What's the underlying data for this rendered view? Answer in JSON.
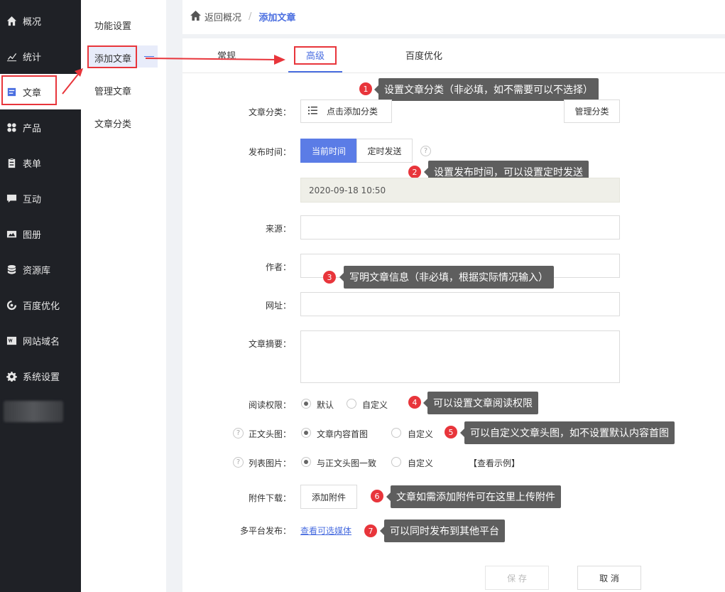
{
  "sidebar": {
    "items": [
      {
        "label": "概况",
        "icon": "home-icon"
      },
      {
        "label": "统计",
        "icon": "stats-icon"
      },
      {
        "label": "文章",
        "icon": "article-icon"
      },
      {
        "label": "产品",
        "icon": "product-icon"
      },
      {
        "label": "表单",
        "icon": "form-icon"
      },
      {
        "label": "互动",
        "icon": "chat-icon"
      },
      {
        "label": "图册",
        "icon": "gallery-icon"
      },
      {
        "label": "资源库",
        "icon": "database-icon"
      },
      {
        "label": "百度优化",
        "icon": "seo-icon"
      },
      {
        "label": "网站域名",
        "icon": "domain-icon"
      },
      {
        "label": "系统设置",
        "icon": "gear-icon"
      }
    ]
  },
  "submenu": {
    "items": [
      "功能设置",
      "添加文章",
      "管理文章",
      "文章分类"
    ]
  },
  "breadcrumb": {
    "back": "返回概况",
    "separator": "/",
    "current": "添加文章"
  },
  "tabs": [
    "常规",
    "高级",
    "百度优化"
  ],
  "form": {
    "category_label": "文章分类：",
    "category_add": "点击添加分类",
    "category_manage": "管理分类",
    "publish_label": "发布时间：",
    "publish_now": "当前时间",
    "publish_timed": "定时发送",
    "publish_value": "2020-09-18 10:50",
    "source_label": "来源：",
    "author_label": "作者：",
    "url_label": "网址：",
    "summary_label": "文章摘要：",
    "read_label": "阅读权限：",
    "read_default": "默认",
    "read_custom": "自定义",
    "header_label": "正文头图：",
    "header_first": "文章内容首图",
    "header_custom": "自定义",
    "list_label": "列表图片：",
    "list_same": "与正文头图一致",
    "list_custom": "自定义",
    "list_example": "【查看示例】",
    "attach_label": "附件下载：",
    "attach_add": "添加附件",
    "multi_label": "多平台发布：",
    "multi_link": "查看可选媒体",
    "save": "保 存",
    "cancel": "取 消"
  },
  "tips": [
    {
      "num": "1",
      "text": "设置文章分类（非必填，如不需要可以不选择）"
    },
    {
      "num": "2",
      "text": "设置发布时间，可以设置定时发送"
    },
    {
      "num": "3",
      "text": "写明文章信息（非必填，根据实际情况输入）"
    },
    {
      "num": "4",
      "text": "可以设置文章阅读权限"
    },
    {
      "num": "5",
      "text": "可以自定义文章头图，如不设置默认内容首图"
    },
    {
      "num": "6",
      "text": "文章如需添加附件可在这里上传附件"
    },
    {
      "num": "7",
      "text": "可以同时发布到其他平台"
    }
  ],
  "qmark": "?",
  "colors": {
    "accent": "#4a6ee0",
    "highlight": "#e8353b",
    "sidebar_bg": "#1f2126",
    "tip_bg": "#5e5e5e"
  }
}
